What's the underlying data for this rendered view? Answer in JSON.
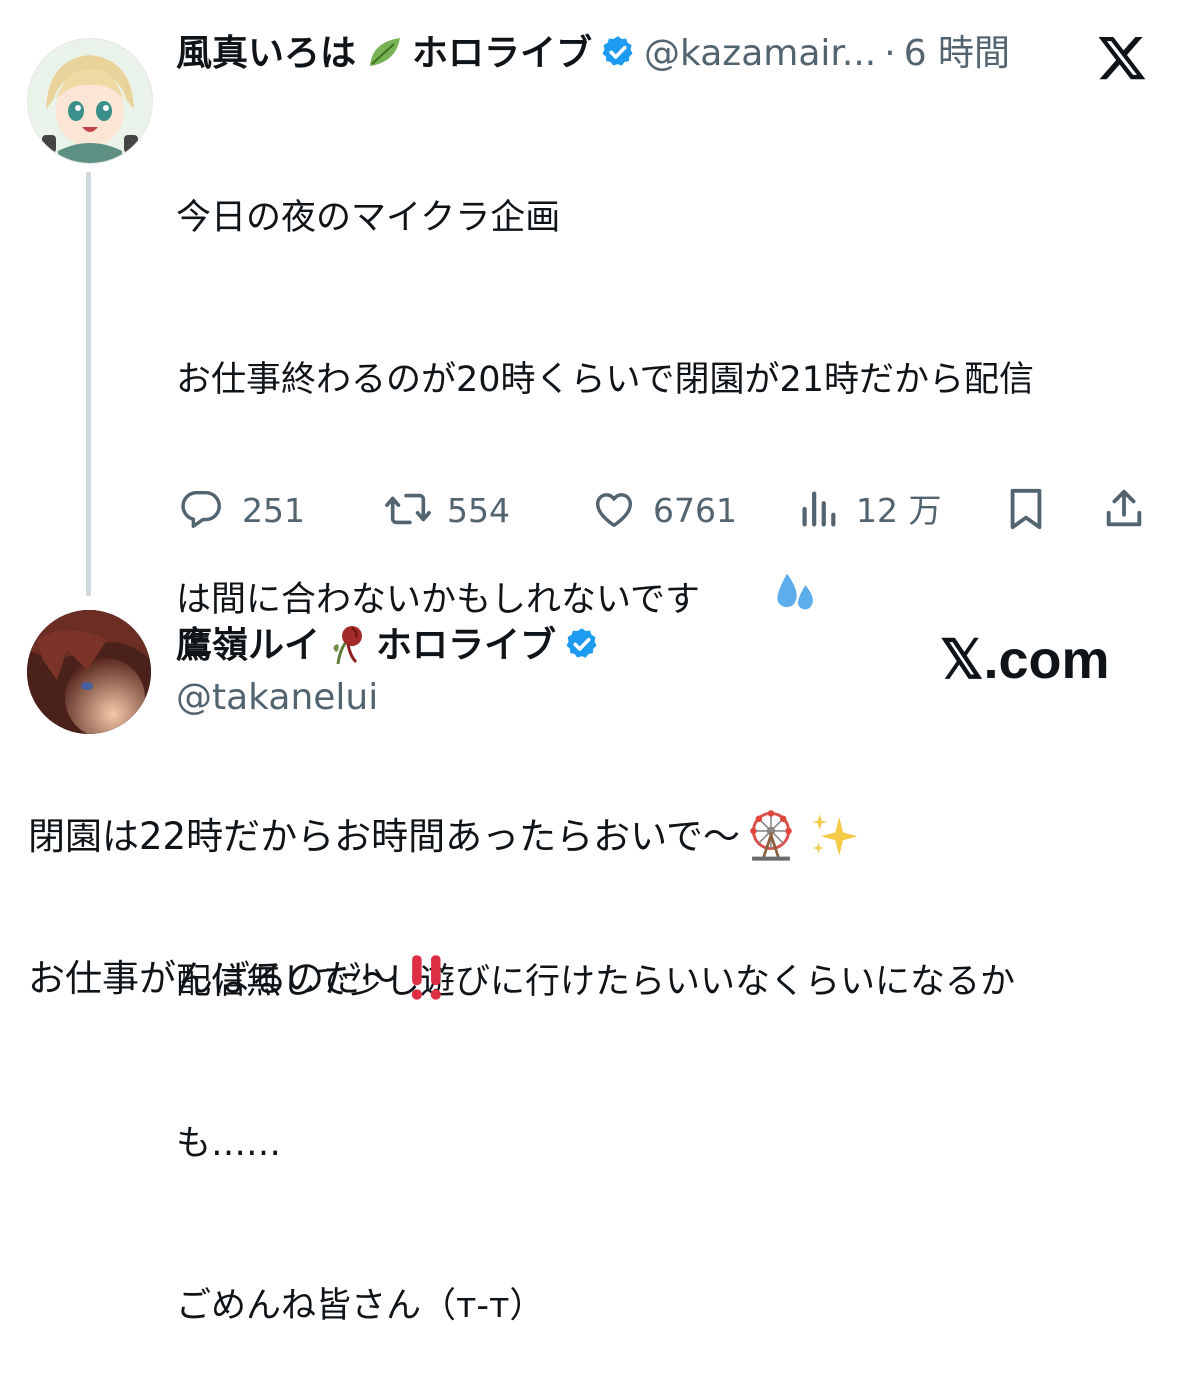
{
  "quoted_tweet": {
    "display_name": "風真いろは",
    "affiliation": "ホロライブ",
    "handle": "@kazamair...",
    "separator": "·",
    "time": "6 時間",
    "lines": [
      "今日の夜のマイクラ企画",
      "お仕事終わるのが20時くらいで閉園が21時だから配信",
      "は間に合わないかもしれないです",
      "配信無しで少し遊びに行けたらいいなくらいになるか",
      "も……",
      "ごめんね皆さん（т-т）"
    ],
    "actions": {
      "replies": "251",
      "reposts": "554",
      "likes": "6761",
      "views": "12 万"
    }
  },
  "reply_tweet": {
    "display_name": "鷹嶺ルイ",
    "affiliation": "ホロライブ",
    "handle": "@takanelui",
    "brand": "𝕏.com",
    "line1": "閉園は22時だからお時間あったらおいで〜",
    "line2": "お仕事がんばるのだ〜"
  },
  "icons": {
    "x_logo": "x-logo-icon",
    "verified": "verified-badge-icon",
    "leaf": "leaf-emoji",
    "wilted_rose": "wilted-rose-emoji",
    "sweat": "sweat-droplets-emoji",
    "ferris_wheel": "ferris-wheel-emoji",
    "sparkles": "sparkles-emoji",
    "double_exclamation": "double-exclamation-emoji"
  },
  "colors": {
    "text": "#0f1419",
    "secondary": "#536471",
    "verified_blue": "#1d9bf0",
    "thread_line": "#cfd9de"
  }
}
